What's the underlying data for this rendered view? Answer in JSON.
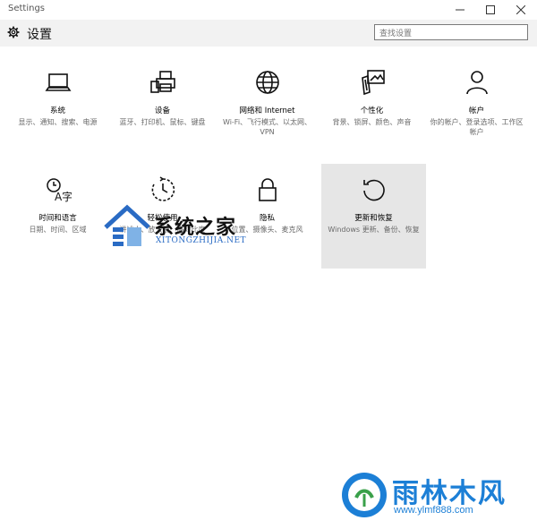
{
  "window": {
    "title": "Settings"
  },
  "header": {
    "title": "设置",
    "search_placeholder": "查找设置"
  },
  "tiles": [
    {
      "icon": "laptop-icon",
      "name": "系统",
      "desc": "显示、通知、搜索、电源"
    },
    {
      "icon": "printer-icon",
      "name": "设备",
      "desc": "蓝牙、打印机、鼠标、键盘"
    },
    {
      "icon": "globe-icon",
      "name": "网络和 Internet",
      "desc": "Wi-Fi、飞行模式、以太网、VPN"
    },
    {
      "icon": "paint-icon",
      "name": "个性化",
      "desc": "背景、锁屏、颜色、声音"
    },
    {
      "icon": "person-icon",
      "name": "帐户",
      "desc": "你的帐户、登录选项、工作区帐户"
    },
    {
      "icon": "time-language-icon",
      "name": "时间和语言",
      "desc": "日期、时间、区域"
    },
    {
      "icon": "ease-of-access-icon",
      "name": "轻松使用",
      "desc": "讲述人、放大镜、高对比度"
    },
    {
      "icon": "lock-icon",
      "name": "隐私",
      "desc": "位置、摄像头、麦克风"
    },
    {
      "icon": "refresh-icon",
      "name": "更新和恢复",
      "desc": "Windows 更新、备份、恢复"
    }
  ],
  "watermarks": {
    "site1_name": "系统之家",
    "site1_url": "XITONGZHIJIA.NET",
    "site2_name": "雨林木风",
    "site2_url": "www.ylmf888.com"
  },
  "colors": {
    "header_bg": "#f2f2f2",
    "selected_tile_bg": "#e6e6e6",
    "brand_blue": "#1c7fd6"
  }
}
